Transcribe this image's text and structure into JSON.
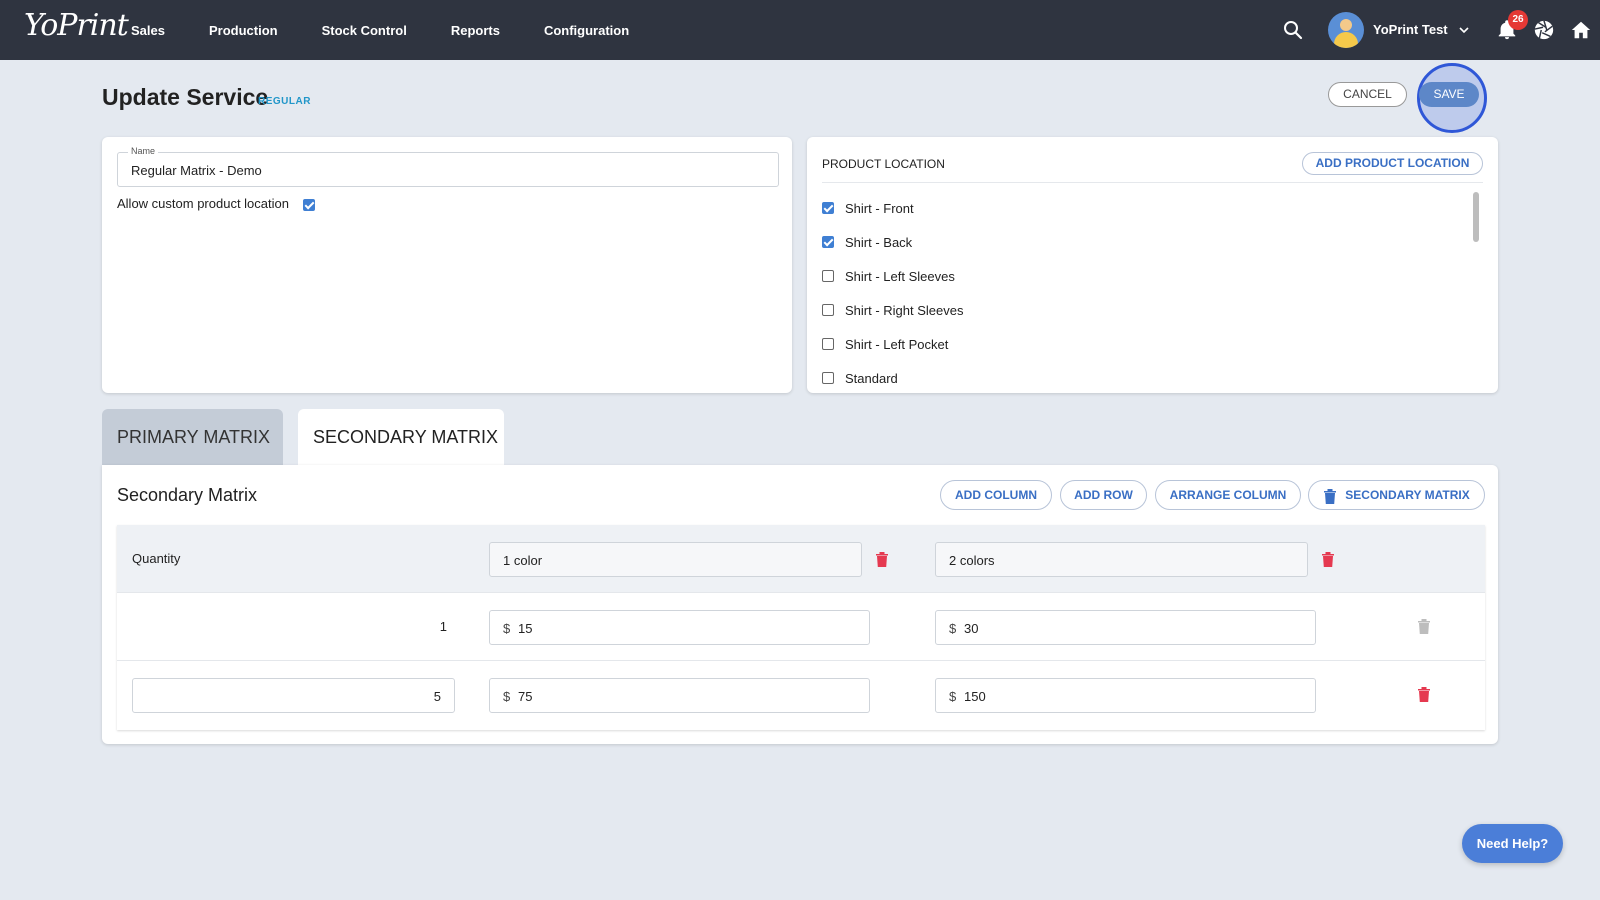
{
  "app": {
    "logo": "YoPrint"
  },
  "nav": {
    "items": [
      "Sales",
      "Production",
      "Stock Control",
      "Reports",
      "Configuration"
    ]
  },
  "user": {
    "name": "YoPrint Test",
    "notifications": "26"
  },
  "page": {
    "title": "Update Service",
    "subtitle": "REGULAR",
    "cancel_label": "CANCEL",
    "save_label": "SAVE"
  },
  "details": {
    "name_label": "Name",
    "name_value": "Regular Matrix - Demo",
    "allow_custom_label": "Allow custom product location",
    "allow_custom_checked": true
  },
  "product_location": {
    "header": "PRODUCT LOCATION",
    "add_label": "ADD PRODUCT LOCATION",
    "items": [
      {
        "label": "Shirt - Front",
        "checked": true
      },
      {
        "label": "Shirt - Back",
        "checked": true
      },
      {
        "label": "Shirt - Left Sleeves",
        "checked": false
      },
      {
        "label": "Shirt - Right Sleeves",
        "checked": false
      },
      {
        "label": "Shirt - Left Pocket",
        "checked": false
      },
      {
        "label": "Standard",
        "checked": false
      }
    ]
  },
  "tabs": {
    "primary": "PRIMARY MATRIX",
    "secondary": "SECONDARY MATRIX",
    "active": "secondary"
  },
  "matrix": {
    "title": "Secondary Matrix",
    "buttons": {
      "add_column": "ADD COLUMN",
      "add_row": "ADD ROW",
      "arrange_column": "ARRANGE COLUMN",
      "delete_matrix": "SECONDARY MATRIX"
    },
    "quantity_label": "Quantity",
    "columns": [
      "1 color",
      "2 colors"
    ],
    "currency": "$",
    "rows": [
      {
        "quantity": "1",
        "values": [
          "15",
          "30"
        ]
      },
      {
        "quantity": "5",
        "values": [
          "75",
          "150"
        ]
      }
    ]
  },
  "help": {
    "label": "Need Help?"
  },
  "colors": {
    "topbar": "#2f3440",
    "accent": "#3a6fc4",
    "danger": "#e53950",
    "disabled": "#bdbdbd"
  }
}
